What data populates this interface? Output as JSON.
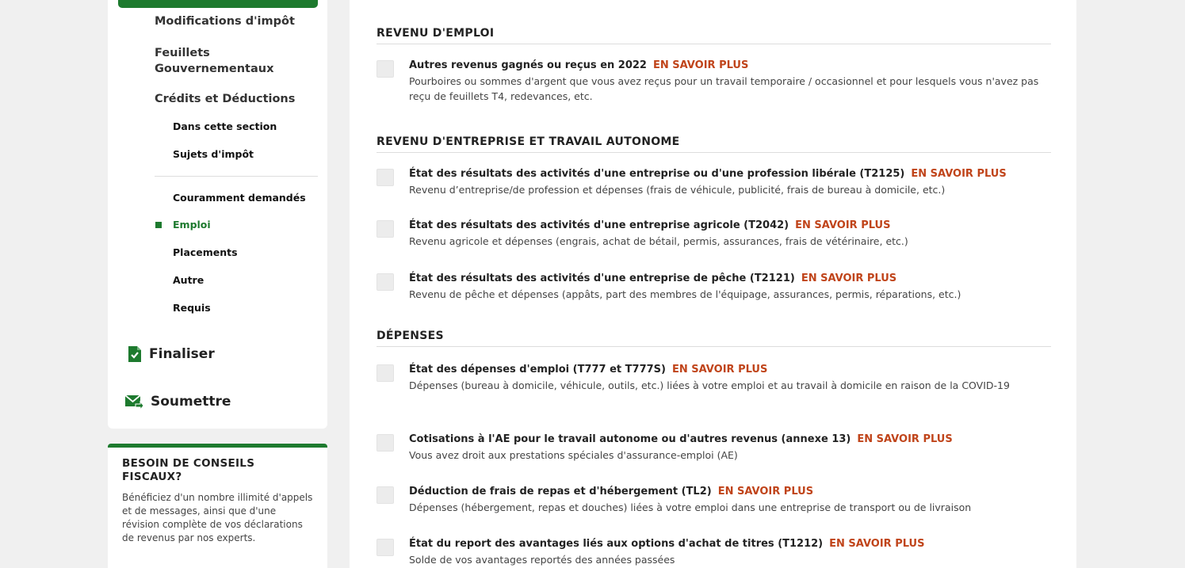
{
  "sidebar": {
    "items": [
      {
        "label": "Modifications d'impôt"
      },
      {
        "label": "Feuillets Gouvernementaux"
      },
      {
        "label": "Crédits et Déductions"
      }
    ],
    "sub_items": [
      {
        "label": "Dans cette section"
      },
      {
        "label": "Sujets d'impôt"
      },
      {
        "label": "Couramment demandés"
      },
      {
        "label": "Emploi"
      },
      {
        "label": "Placements"
      },
      {
        "label": "Autre"
      },
      {
        "label": "Requis"
      }
    ],
    "finalize": {
      "label": "Finaliser",
      "icon": "document-check-icon"
    },
    "submit": {
      "label": "Soumettre",
      "icon": "send-mail-icon"
    }
  },
  "advice": {
    "title": "BESOIN DE CONSEILS FISCAUX?",
    "text": "Bénéficiez d'un nombre illimité d'appels et de messages, ainsi que d'une révision complète de vos déclarations de revenus par nos experts."
  },
  "colors": {
    "brand_green": "#1d7a2e",
    "link_orange": "#c0441a"
  },
  "main": {
    "learn_more": "EN SAVOIR PLUS",
    "sections": [
      {
        "title": "REVENU D'EMPLOI",
        "items": [
          {
            "title": "Autres revenus gagnés ou reçus en 2022",
            "desc": "Pourboires ou sommes d'argent que vous avez reçus pour un travail temporaire / occasionnel et pour lesquels vous n'avez pas reçu de feuillets T4, redevances, etc."
          }
        ]
      },
      {
        "title": "REVENU D'ENTREPRISE ET TRAVAIL AUTONOME",
        "items": [
          {
            "title": "État des résultats des activités d'une entreprise ou d'une profession libérale (T2125)",
            "desc": "Revenu d’entreprise/de profession et dépenses (frais de véhicule, publicité, frais de bureau à domicile, etc.)"
          },
          {
            "title": "État des résultats des activités d'une entreprise agricole (T2042)",
            "desc": "Revenu agricole et dépenses (engrais, achat de bétail, permis, assurances, frais de vétérinaire, etc.)"
          },
          {
            "title": "État des résultats des activités d'une entreprise de pêche (T2121)",
            "desc": "Revenu de pêche et dépenses (appâts, part des membres de l'équipage, assurances, permis, réparations, etc.)"
          }
        ]
      },
      {
        "title": "DÉPENSES",
        "items": [
          {
            "title": "État des dépenses d'emploi (T777 et T777S)",
            "desc": "Dépenses (bureau à domicile, véhicule, outils, etc.) liées à votre emploi et au travail à domicile en raison de la COVID-19"
          },
          {
            "title": "Cotisations à l'AE pour le travail autonome ou d'autres revenus (annexe 13)",
            "desc": "Vous avez droit aux prestations spéciales d'assurance-emploi (AE)"
          },
          {
            "title": "Déduction de frais de repas et d'hébergement (TL2)",
            "desc": "Dépenses (hébergement, repas et douches) liées à votre emploi dans une entreprise de transport ou de livraison"
          },
          {
            "title": "État du report des avantages liés aux options d'achat de titres (T1212)",
            "desc": "Solde de vos avantages reportés des années passées"
          }
        ]
      }
    ]
  }
}
